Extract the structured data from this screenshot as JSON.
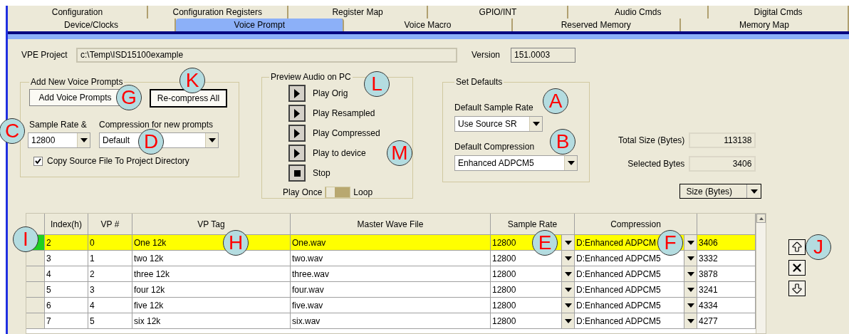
{
  "tabs_row_1": [
    {
      "label": "Configuration",
      "selected": false
    },
    {
      "label": "Configuration Registers",
      "selected": false
    },
    {
      "label": "Register Map",
      "selected": false
    },
    {
      "label": "GPIO/INT",
      "selected": false
    },
    {
      "label": "Audio Cmds",
      "selected": false
    },
    {
      "label": "Digital Cmds",
      "selected": false
    }
  ],
  "tabs_row_2": [
    {
      "label": "Device/Clocks",
      "selected": false
    },
    {
      "label": "Voice Prompt",
      "selected": true
    },
    {
      "label": "Voice Macro",
      "selected": false
    },
    {
      "label": "Reserved Memory",
      "selected": false
    },
    {
      "label": "Memory Map",
      "selected": false
    }
  ],
  "project": {
    "label": "VPE Project",
    "value": "c:\\Temp\\ISD15100example",
    "version_label": "Version",
    "version": "151.0003"
  },
  "add_group": {
    "title": "Add New Voice Prompts",
    "add_button": {
      "label": "Add Voice Prompts",
      "callout": "G"
    },
    "recompress_button": {
      "label": "Re-compress All",
      "callout": "K"
    },
    "sample_rate_label": "Sample Rate &",
    "sample_rate": {
      "value": "12800",
      "callout": "C"
    },
    "compression_label": "Compression for new prompts",
    "compression": {
      "value": "Default",
      "callout": "D"
    },
    "copy_checkbox": {
      "label": "Copy Source File To Project Directory",
      "checked": true
    }
  },
  "preview_group": {
    "title": "Preview Audio on PC",
    "callout": "L",
    "buttons": [
      {
        "kind": "play",
        "label": "Play Orig"
      },
      {
        "kind": "play",
        "label": "Play Resampled"
      },
      {
        "kind": "play",
        "label": "Play Compressed"
      },
      {
        "kind": "play",
        "label": "Play to device",
        "callout": "M"
      },
      {
        "kind": "stop",
        "label": "Stop"
      }
    ],
    "mode": {
      "left_label": "Play Once",
      "right_label": "Loop",
      "loop": false
    }
  },
  "defaults_group": {
    "title": "Set Defaults",
    "sample_rate_label": "Default Sample Rate",
    "sample_rate_callout": "A",
    "sample_rate": "Use Source SR",
    "compression_label": "Default Compression",
    "compression_callout": "B",
    "compression": "Enhanced ADPCM5"
  },
  "totals": [
    {
      "label": "Total Size (Bytes)",
      "value": "113138"
    },
    {
      "label": "Selected Bytes",
      "value": "3406"
    }
  ],
  "size_unit": "Size (Bytes)",
  "table": {
    "columns": [
      "Index(h)",
      "VP #",
      "VP Tag",
      "Master Wave File",
      "Sample Rate",
      "Compression"
    ],
    "rows": [
      {
        "selected": true,
        "cells": [
          "2",
          "0",
          "One 12k",
          "One.wav",
          "12800",
          "D:Enhanced ADPCM",
          "3406"
        ],
        "callouts": {
          "row_header": "I",
          "vp_tag": "H",
          "sample_rate": "E",
          "compression": "F"
        }
      },
      {
        "selected": false,
        "cells": [
          "3",
          "1",
          "two 12k",
          "two.wav",
          "12800",
          "D:Enhanced ADPCM5",
          "3332"
        ]
      },
      {
        "selected": false,
        "cells": [
          "4",
          "2",
          "three 12k",
          "three.wav",
          "12800",
          "D:Enhanced ADPCM5",
          "3878"
        ]
      },
      {
        "selected": false,
        "cells": [
          "5",
          "3",
          "four 12k",
          "four.wav",
          "12800",
          "D:Enhanced ADPCM5",
          "3241"
        ]
      },
      {
        "selected": false,
        "cells": [
          "6",
          "4",
          "five 12k",
          "five.wav",
          "12800",
          "D:Enhanced ADPCM5",
          "4334"
        ]
      },
      {
        "selected": false,
        "cells": [
          "7",
          "5",
          "six 12k",
          "six.wav",
          "12800",
          "D:Enhanced ADPCM5",
          "4277"
        ]
      }
    ]
  },
  "side_buttons": [
    {
      "kind": "up",
      "callout": "J"
    },
    {
      "kind": "delete"
    },
    {
      "kind": "down"
    }
  ]
}
